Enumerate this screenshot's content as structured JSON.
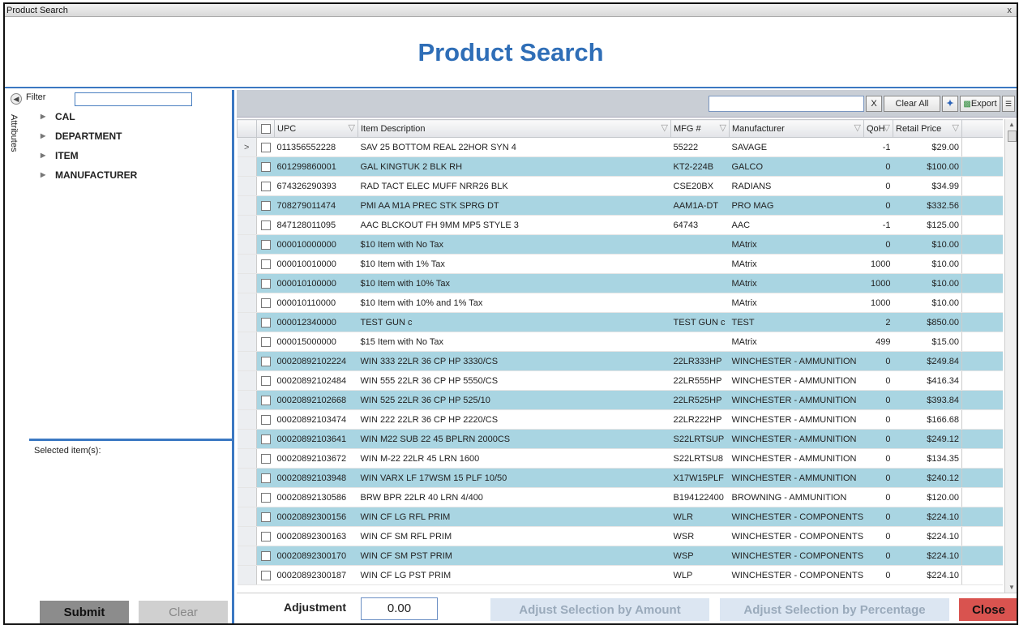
{
  "window": {
    "title": "Product Search",
    "close_glyph": "x"
  },
  "header": {
    "title": "Product Search"
  },
  "left_panel": {
    "filter_label": "Filter",
    "attributes_tab": "Attributes",
    "tree": [
      "CAL",
      "DEPARTMENT",
      "ITEM",
      "MANUFACTURER"
    ],
    "selected_label": "Selected item(s):",
    "submit_label": "Submit",
    "clear_label": "Clear"
  },
  "toolbar": {
    "search_value": "",
    "x_label": "X",
    "clear_all_label": "Clear All",
    "export_label": "Export"
  },
  "grid": {
    "columns": [
      "UPC",
      "Item Description",
      "MFG #",
      "Manufacturer",
      "QoH",
      "Retail Price"
    ],
    "rows": [
      [
        "011356552228",
        "SAV 25 BOTTOM REAL 22HOR SYN 4",
        "55222",
        "SAVAGE",
        "-1",
        "$29.00"
      ],
      [
        "601299860001",
        "GAL KINGTUK 2 BLK RH",
        "KT2-224B",
        "GALCO",
        "0",
        "$100.00"
      ],
      [
        "674326290393",
        "RAD TACT ELEC MUFF NRR26 BLK",
        "CSE20BX",
        "RADIANS",
        "0",
        "$34.99"
      ],
      [
        "708279011474",
        "PMI AA M1A PREC STK SPRG DT",
        "AAM1A-DT",
        "PRO MAG",
        "0",
        "$332.56"
      ],
      [
        "847128011095",
        "AAC BLCKOUT FH 9MM MP5 STYLE 3",
        "64743",
        "AAC",
        "-1",
        "$125.00"
      ],
      [
        "000010000000",
        "$10 Item with No Tax",
        "",
        "MAtrix",
        "0",
        "$10.00"
      ],
      [
        "000010010000",
        "$10 Item with 1% Tax",
        "",
        "MAtrix",
        "1000",
        "$10.00"
      ],
      [
        "000010100000",
        "$10 Item with 10% Tax",
        "",
        "MAtrix",
        "1000",
        "$10.00"
      ],
      [
        "000010110000",
        "$10 Item with 10% and 1% Tax",
        "",
        "MAtrix",
        "1000",
        "$10.00"
      ],
      [
        "000012340000",
        "TEST GUN c",
        "TEST GUN c",
        "TEST",
        "2",
        "$850.00"
      ],
      [
        "000015000000",
        "$15 Item with No Tax",
        "",
        "MAtrix",
        "499",
        "$15.00"
      ],
      [
        "00020892102224",
        "WIN 333 22LR 36 CP HP 3330/CS",
        "22LR333HP",
        "WINCHESTER - AMMUNITION",
        "0",
        "$249.84"
      ],
      [
        "00020892102484",
        "WIN 555 22LR 36 CP HP 5550/CS",
        "22LR555HP",
        "WINCHESTER - AMMUNITION",
        "0",
        "$416.34"
      ],
      [
        "00020892102668",
        "WIN 525 22LR 36 CP HP 525/10",
        "22LR525HP",
        "WINCHESTER - AMMUNITION",
        "0",
        "$393.84"
      ],
      [
        "00020892103474",
        "WIN 222 22LR 36 CP HP 2220/CS",
        "22LR222HP",
        "WINCHESTER - AMMUNITION",
        "0",
        "$166.68"
      ],
      [
        "00020892103641",
        "WIN M22 SUB 22 45 BPLRN 2000CS",
        "S22LRTSUP",
        "WINCHESTER - AMMUNITION",
        "0",
        "$249.12"
      ],
      [
        "00020892103672",
        "WIN M-22 22LR 45 LRN 1600",
        "S22LRTSU8",
        "WINCHESTER - AMMUNITION",
        "0",
        "$134.35"
      ],
      [
        "00020892103948",
        "WIN VARX LF 17WSM 15 PLF 10/50",
        "X17W15PLF",
        "WINCHESTER - AMMUNITION",
        "0",
        "$240.12"
      ],
      [
        "00020892130586",
        "BRW BPR 22LR 40 LRN 4/400",
        "B194122400",
        "BROWNING - AMMUNITION",
        "0",
        "$120.00"
      ],
      [
        "00020892300156",
        "WIN CF LG RFL PRIM",
        "WLR",
        "WINCHESTER - COMPONENTS",
        "0",
        "$224.10"
      ],
      [
        "00020892300163",
        "WIN CF SM RFL PRIM",
        "WSR",
        "WINCHESTER - COMPONENTS",
        "0",
        "$224.10"
      ],
      [
        "00020892300170",
        "WIN CF SM PST PRIM",
        "WSP",
        "WINCHESTER - COMPONENTS",
        "0",
        "$224.10"
      ],
      [
        "00020892300187",
        "WIN CF LG PST PRIM",
        "WLP",
        "WINCHESTER - COMPONENTS",
        "0",
        "$224.10"
      ]
    ],
    "current_row_indicator": ">"
  },
  "bottom": {
    "adjustment_label": "Adjustment",
    "adjustment_value": "0.00",
    "adjust_amount_label": "Adjust Selection by Amount",
    "adjust_percent_label": "Adjust Selection by Percentage",
    "close_label": "Close"
  },
  "colors": {
    "accent": "#2f6eb7",
    "row_alt": "#a9d5e2",
    "close": "#d9534f"
  }
}
